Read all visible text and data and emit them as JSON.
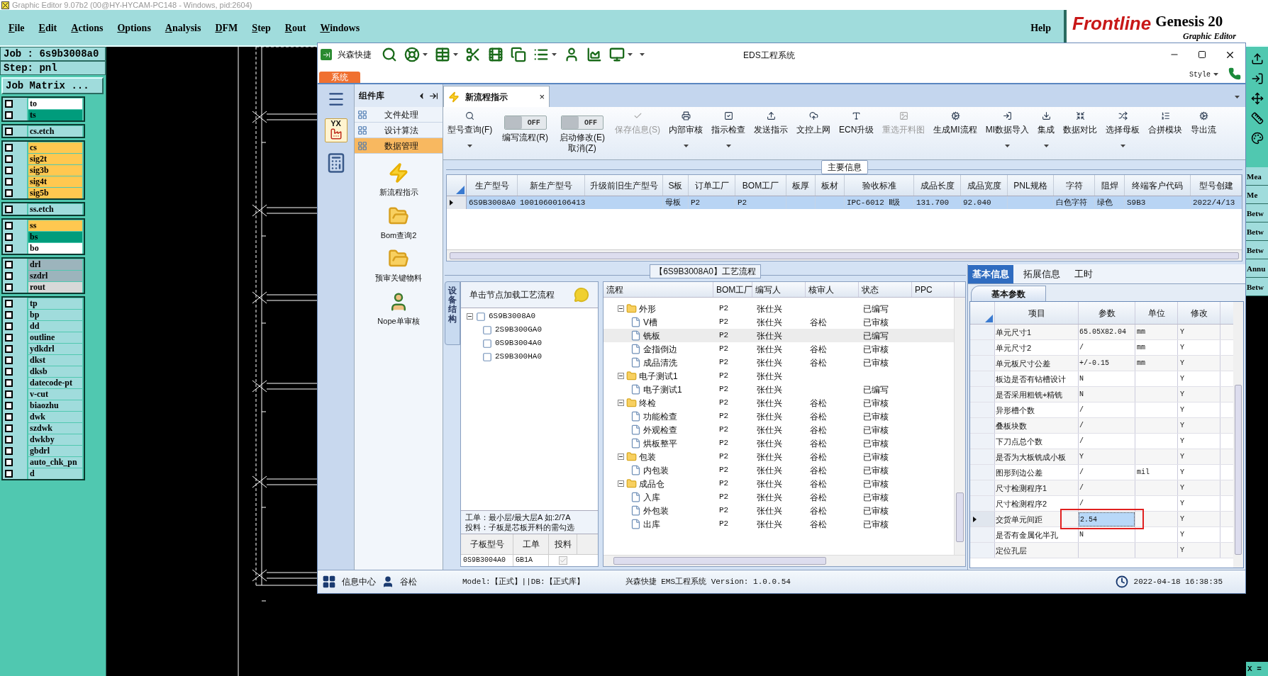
{
  "genesis": {
    "title": "Graphic Editor 9.07b2 (00@HY-HYCAM-PC148 - Windows, pid:2604)",
    "menu": [
      "File",
      "Edit",
      "Actions",
      "Options",
      "Analysis",
      "DFM",
      "Step",
      "Rout",
      "Windows"
    ],
    "help": "Help",
    "brand": {
      "logo": "Frontline",
      "product": "Genesis 20",
      "subtitle": "Graphic Editor"
    },
    "job": "Job : 6s9b3008a0",
    "step": "Step: pnl",
    "job_matrix": "Job Matrix ...",
    "layer_groups": [
      {
        "layers": [
          {
            "name": "to",
            "color": "#ffffff",
            "checked": false
          },
          {
            "name": "ts",
            "color": "#009c7c",
            "checked": false
          }
        ]
      },
      {
        "layers": [
          {
            "name": "cs.etch",
            "color": "#a0dcdc",
            "checked": false
          }
        ]
      },
      {
        "layers": [
          {
            "name": "cs",
            "color": "#ffc850",
            "checked": false
          },
          {
            "name": "sig2t",
            "color": "#ffc850",
            "checked": false
          },
          {
            "name": "sig3b",
            "color": "#ffc850",
            "checked": false
          },
          {
            "name": "sig4t",
            "color": "#ffc850",
            "checked": false
          },
          {
            "name": "sig5b",
            "color": "#ffc850",
            "checked": false
          }
        ]
      },
      {
        "layers": [
          {
            "name": "ss.etch",
            "color": "#a0dcdc",
            "checked": false
          }
        ]
      },
      {
        "layers": [
          {
            "name": "ss",
            "color": "#ffc850",
            "checked": false
          },
          {
            "name": "bs",
            "color": "#009c7c",
            "checked": false
          },
          {
            "name": "bo",
            "color": "#ffffff",
            "checked": false
          }
        ]
      },
      {
        "layers": [
          {
            "name": "drl",
            "color": "#9cb4bc",
            "checked": false
          },
          {
            "name": "szdrl",
            "color": "#9cb4bc",
            "checked": false
          },
          {
            "name": "rout",
            "color": "#d8d8d8",
            "checked": false
          }
        ]
      },
      {
        "layers": [
          {
            "name": "tp",
            "color": "#a0dcdc",
            "checked": false
          },
          {
            "name": "bp",
            "color": "#a0dcdc",
            "checked": false
          },
          {
            "name": "dd",
            "color": "#a0dcdc",
            "checked": false
          },
          {
            "name": "outline",
            "color": "#a0dcdc",
            "checked": false
          },
          {
            "name": "ydkdrl",
            "color": "#a0dcdc",
            "checked": false
          },
          {
            "name": "dkst",
            "color": "#a0dcdc",
            "checked": false
          },
          {
            "name": "dksb",
            "color": "#a0dcdc",
            "checked": false
          },
          {
            "name": "datecode-pt",
            "color": "#a0dcdc",
            "checked": false
          },
          {
            "name": "v-cut",
            "color": "#a0dcdc",
            "checked": false
          },
          {
            "name": "biaozhu",
            "color": "#a0dcdc",
            "checked": false
          },
          {
            "name": "dwk",
            "color": "#a0dcdc",
            "checked": false
          },
          {
            "name": "szdwk",
            "color": "#a0dcdc",
            "checked": false
          },
          {
            "name": "dwkby",
            "color": "#a0dcdc",
            "checked": false
          },
          {
            "name": "gbdrl",
            "color": "#a0dcdc",
            "checked": false
          },
          {
            "name": "auto_chk_pn",
            "color": "#a0dcdc",
            "checked": false
          },
          {
            "name": "d",
            "color": "#a0dcdc",
            "checked": false
          }
        ]
      }
    ],
    "side_strip": [
      "Mea",
      "Me",
      "Betw",
      "Betw",
      "Betw",
      "Annu",
      "Betw"
    ],
    "coord": "X ="
  },
  "eds": {
    "app_name": "兴森快捷",
    "title": "EDS工程系统",
    "system_tab": "系统",
    "style": "Style",
    "nav_badge": "YX",
    "component_panel": {
      "title": "组件库",
      "groups": [
        {
          "label": "文件处理",
          "selected": false
        },
        {
          "label": "设计算法",
          "selected": false
        },
        {
          "label": "数据管理",
          "selected": true
        }
      ],
      "items": [
        {
          "label": "新流程指示",
          "kind": "flash"
        },
        {
          "label": "Bom查询2",
          "kind": "folder"
        },
        {
          "label": "预审关键物料",
          "kind": "folder"
        },
        {
          "label": "Nope单审核",
          "kind": "person"
        }
      ]
    },
    "doc_tab": {
      "label": "新流程指示",
      "close": "×"
    },
    "ribbon": [
      {
        "kind": "button",
        "label": "型号查询(F)",
        "disabled": false,
        "dropdown": true
      },
      {
        "kind": "toggle",
        "label": "编写流程(R)",
        "toggle_text": "OFF",
        "on": false
      },
      {
        "kind": "toggle",
        "label": "启动修改(E)",
        "sub": "取消(Z)",
        "toggle_text": "OFF",
        "on": false
      },
      {
        "kind": "button",
        "label": "保存信息(S)",
        "disabled": true,
        "dropdown": false
      },
      {
        "kind": "button",
        "label": "内部审核",
        "disabled": false,
        "dropdown": true
      },
      {
        "kind": "button",
        "label": "指示检查",
        "disabled": false,
        "dropdown": true
      },
      {
        "kind": "button",
        "label": "发送指示",
        "disabled": false,
        "dropdown": false
      },
      {
        "kind": "button",
        "label": "文控上网",
        "disabled": false,
        "dropdown": false
      },
      {
        "kind": "button",
        "label": "ECN升级",
        "disabled": false,
        "dropdown": false
      },
      {
        "kind": "button",
        "label": "重选开料图",
        "disabled": true,
        "dropdown": false
      },
      {
        "kind": "button",
        "label": "生成MI流程",
        "disabled": false,
        "dropdown": false
      },
      {
        "kind": "button",
        "label": "MI数据导入",
        "disabled": false,
        "dropdown": true
      },
      {
        "kind": "button",
        "label": "集成",
        "disabled": false,
        "dropdown": true
      },
      {
        "kind": "button",
        "label": "数据对比",
        "disabled": false,
        "dropdown": false
      },
      {
        "kind": "button",
        "label": "选择母板",
        "disabled": false,
        "dropdown": true
      },
      {
        "kind": "button",
        "label": "合拼模块",
        "disabled": false,
        "dropdown": false
      },
      {
        "kind": "button",
        "label": "导出流",
        "disabled": false,
        "dropdown": false
      }
    ],
    "main_info": {
      "title": "主要信息",
      "columns": [
        "生产型号",
        "新生产型号",
        "升级前旧生产型号",
        "S板",
        "订单工厂",
        "BOM工厂",
        "板厚",
        "板材",
        "验收标准",
        "成品长度",
        "成品宽度",
        "PNL规格",
        "字符",
        "阻焊",
        "终端客户代码",
        "型号创建"
      ],
      "rows": [
        {
          "selected": true,
          "cells": [
            "6S9B3008A0",
            "10010600106413",
            null,
            "母板",
            "P2",
            "P2",
            null,
            null,
            "IPC-6012 Ⅱ级",
            "131.700",
            "92.040",
            null,
            "白色字符",
            "绿色",
            "S9B3",
            "2022/4/13"
          ]
        }
      ]
    },
    "flow": {
      "title": "【6S9B3008A0】工艺流程",
      "side_tab": "设备结构",
      "hint": "单击节点加载工艺流程",
      "tree": [
        {
          "label": "6S9B3008A0",
          "expanded": true,
          "children": [
            {
              "label": "2S9B300GA0"
            },
            {
              "label": "0S9B3004A0"
            },
            {
              "label": "2S9B300HA0"
            }
          ]
        }
      ],
      "note": [
        "工单：最小层/最大层A 如:2/7A",
        "投料：子板是芯板开料的需勾选"
      ],
      "sub_table": {
        "columns": [
          "子板型号",
          "工单",
          "投料"
        ],
        "rows": [
          {
            "cells": [
              "0S9B3004A0",
              "GB1A"
            ],
            "checked": true
          }
        ]
      },
      "grid": {
        "columns": [
          "流程",
          "BOM工厂",
          "编写人",
          "核审人",
          "状态",
          "PPC"
        ],
        "rows": [
          {
            "name": "外形",
            "bom": "P2",
            "writer": "张仕兴",
            "status": "已编写",
            "selected": false,
            "expanded": true,
            "children": [
              {
                "name": "V槽",
                "bom": "P2",
                "writer": "张仕兴",
                "reviewer": "谷松",
                "status": "已审核",
                "selected": false
              },
              {
                "name": "铣板",
                "bom": "P2",
                "writer": "张仕兴",
                "status": "已编写",
                "selected": true
              },
              {
                "name": "金指倒边",
                "bom": "P2",
                "writer": "张仕兴",
                "reviewer": "谷松",
                "status": "已审核",
                "selected": false
              },
              {
                "name": "成品清洗",
                "bom": "P2",
                "writer": "张仕兴",
                "reviewer": "谷松",
                "status": "已审核",
                "selected": false
              }
            ]
          },
          {
            "name": "电子测试1",
            "bom": "P2",
            "writer": "张仕兴",
            "selected": false,
            "expanded": true,
            "children": [
              {
                "name": "电子测试1",
                "bom": "P2",
                "writer": "张仕兴",
                "status": "已编写",
                "selected": false
              }
            ]
          },
          {
            "name": "终检",
            "bom": "P2",
            "writer": "张仕兴",
            "reviewer": "谷松",
            "status": "已审核",
            "selected": false,
            "expanded": true,
            "children": [
              {
                "name": "功能检查",
                "bom": "P2",
                "writer": "张仕兴",
                "reviewer": "谷松",
                "status": "已审核",
                "selected": false
              },
              {
                "name": "外观检查",
                "bom": "P2",
                "writer": "张仕兴",
                "reviewer": "谷松",
                "status": "已审核",
                "selected": false
              },
              {
                "name": "烘板整平",
                "bom": "P2",
                "writer": "张仕兴",
                "reviewer": "谷松",
                "status": "已审核",
                "selected": false
              }
            ]
          },
          {
            "name": "包装",
            "bom": "P2",
            "writer": "张仕兴",
            "reviewer": "谷松",
            "status": "已审核",
            "selected": false,
            "expanded": true,
            "children": [
              {
                "name": "内包装",
                "bom": "P2",
                "writer": "张仕兴",
                "reviewer": "谷松",
                "status": "已审核",
                "selected": false
              }
            ]
          },
          {
            "name": "成品仓",
            "bom": "P2",
            "writer": "张仕兴",
            "reviewer": "谷松",
            "status": "已审核",
            "selected": false,
            "expanded": true,
            "children": [
              {
                "name": "入库",
                "bom": "P2",
                "writer": "张仕兴",
                "reviewer": "谷松",
                "status": "已审核",
                "selected": false
              },
              {
                "name": "外包装",
                "bom": "P2",
                "writer": "张仕兴",
                "reviewer": "谷松",
                "status": "已审核",
                "selected": false
              },
              {
                "name": "出库",
                "bom": "P2",
                "writer": "张仕兴",
                "reviewer": "谷松",
                "status": "已审核",
                "selected": false
              }
            ]
          }
        ]
      }
    },
    "detail": {
      "tabs": [
        {
          "label": "基本信息",
          "selected": true
        },
        {
          "label": "拓展信息",
          "selected": false
        },
        {
          "label": "工时",
          "selected": false
        }
      ],
      "subtab": "基本参数",
      "columns": [
        "项目",
        "参数",
        "单位",
        "修改"
      ],
      "rows": [
        {
          "item": "单元尺寸1",
          "value": "65.05X82.04",
          "unit": "mm",
          "editable": "Y",
          "selected": false
        },
        {
          "item": "单元尺寸2",
          "value": "/",
          "unit": "mm",
          "editable": "Y",
          "selected": false
        },
        {
          "item": "单元板尺寸公差",
          "value": "+/-0.15",
          "unit": "mm",
          "editable": "Y",
          "selected": false
        },
        {
          "item": "板边是否有钻槽设计",
          "value": "N",
          "editable": "Y",
          "selected": false
        },
        {
          "item": "是否采用粗铣+精铣",
          "value": "N",
          "editable": "Y",
          "selected": false
        },
        {
          "item": "异形槽个数",
          "value": "/",
          "editable": "Y",
          "selected": false
        },
        {
          "item": "叠板块数",
          "value": "/",
          "editable": "Y",
          "selected": false
        },
        {
          "item": "下刀点总个数",
          "value": "/",
          "editable": "Y",
          "selected": false
        },
        {
          "item": "是否为大板铣成小板",
          "value": "Y",
          "editable": "Y",
          "selected": false
        },
        {
          "item": "图形到边公差",
          "value": "/",
          "unit": "mil",
          "editable": "Y",
          "selected": false
        },
        {
          "item": "尺寸检测程序1",
          "value": "/",
          "editable": "Y",
          "selected": false
        },
        {
          "item": "尺寸检测程序2",
          "value": "/",
          "editable": "Y",
          "selected": false
        },
        {
          "item": "交货单元间距",
          "value": "2.54",
          "editable": "Y",
          "selected": true
        },
        {
          "item": "是否有金属化半孔",
          "value": "N",
          "editable": "Y",
          "selected": false
        },
        {
          "item": "定位孔层",
          "editable": "Y",
          "selected": false
        }
      ]
    },
    "status_bar": {
      "info": "信息中心",
      "user": "谷松",
      "model": "Model:【正式】||DB:【正式库】",
      "app": "兴森快捷 EMS工程系统 Version: 1.0.0.54",
      "time": "2022-04-18 16:38:35"
    }
  }
}
